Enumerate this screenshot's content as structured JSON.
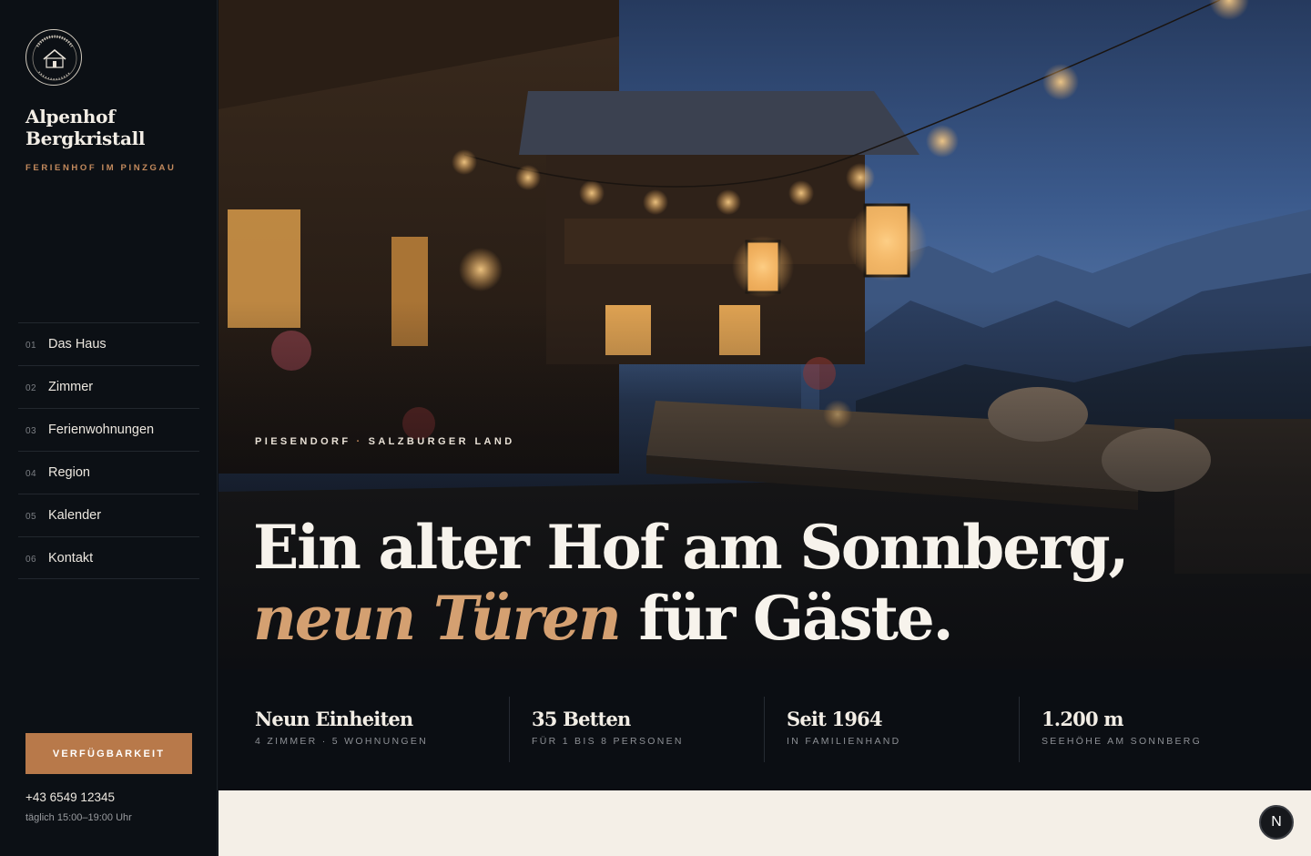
{
  "brand": {
    "logo_text": "ALPENHOF BERGKRISTALL · PIESENDORF · PINZGAU",
    "name_line1": "Alpenhof",
    "name_line2": "Bergkristall",
    "tagline": "FERIENHOF IM PINZGAU"
  },
  "nav": [
    {
      "num": "01",
      "label": "Das Haus"
    },
    {
      "num": "02",
      "label": "Zimmer"
    },
    {
      "num": "03",
      "label": "Ferienwohnungen"
    },
    {
      "num": "04",
      "label": "Region"
    },
    {
      "num": "05",
      "label": "Kalender"
    },
    {
      "num": "06",
      "label": "Kontakt"
    }
  ],
  "cta": {
    "label": "VERFÜGBARKEIT"
  },
  "contact": {
    "phone": "+43 6549 12345",
    "hours": "täglich 15:00–19:00 Uhr"
  },
  "hero": {
    "eyebrow_part1": "PIESENDORF",
    "eyebrow_sep": "·",
    "eyebrow_part2": "SALZBURGER LAND",
    "headline_line1": "Ein alter Hof am Sonnberg,",
    "headline_accent": "neun Türen",
    "headline_rest": " für Gäste."
  },
  "stats": [
    {
      "value": "Neun Einheiten",
      "label": "4 ZIMMER · 5 WOHNUNGEN"
    },
    {
      "value": "35 Betten",
      "label": "FÜR 1 BIS 8 PERSONEN"
    },
    {
      "value": "Seit 1964",
      "label": "IN FAMILIENHAND"
    },
    {
      "value": "1.200 m",
      "label": "SEEHÖHE AM SONNBERG"
    }
  ],
  "floating_button": {
    "label": "N"
  },
  "colors": {
    "accent": "#b8794a",
    "sidebar_bg": "#0c1015",
    "cream": "#f4efe7"
  }
}
